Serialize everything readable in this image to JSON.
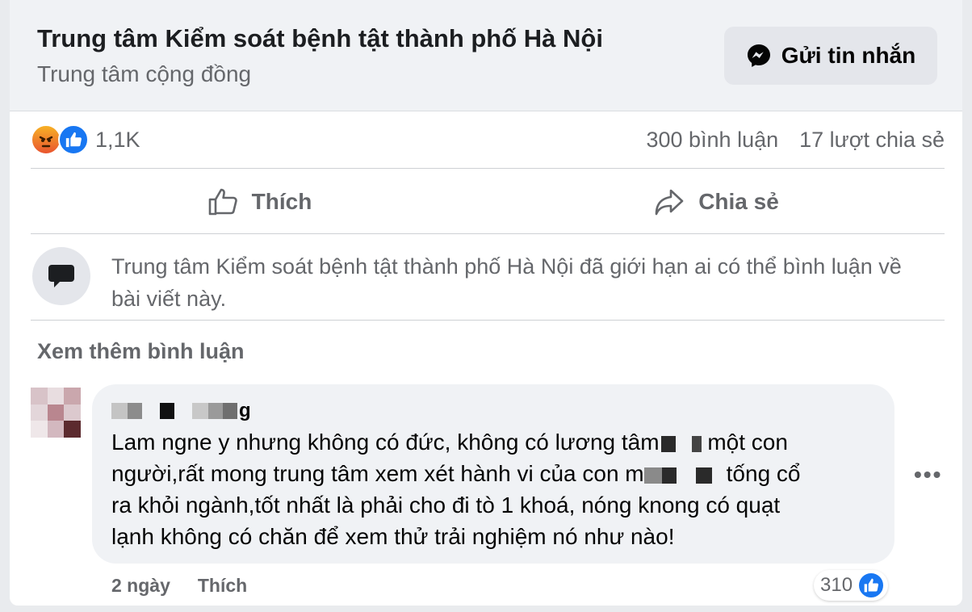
{
  "header": {
    "title": "Trung tâm Kiểm soát bệnh tật thành phố Hà Nội",
    "subtitle": "Trung tâm cộng đồng",
    "message_button": "Gửi tin nhắn"
  },
  "stats": {
    "reaction_count": "1,1K",
    "comments": "300 bình luận",
    "shares": "17 lượt chia sẻ",
    "reaction_icons": [
      "angry-icon",
      "like-icon"
    ]
  },
  "actions": {
    "like": "Thích",
    "share": "Chia sẻ"
  },
  "notice": {
    "text": "Trung tâm Kiểm soát bệnh tật thành phố Hà Nội đã giới hạn ai có thể bình luận về bài viết này."
  },
  "comments_section": {
    "see_more": "Xem thêm bình luận"
  },
  "comment": {
    "name_tail": "g",
    "line1_a": "Lam ngne y nhưng không có đức, không có lương tâm",
    "line1_b": "một con",
    "line2_a": "người,rất mong trung tâm xem xét hành vi của con m",
    "line2_b": "tống cổ",
    "line3": "ra khỏi ngành,tốt nhất là phải cho đi tò 1 khoá, nóng knong có quạt",
    "line4": "lạnh không có chăn để xem thử trải nghiệm nó như nào!",
    "time": "2 ngày",
    "like": "Thích",
    "like_count": "310"
  },
  "colors": {
    "accent": "#1877f2",
    "secondary_text": "#65676b",
    "header_bg": "#f0f2f5"
  }
}
